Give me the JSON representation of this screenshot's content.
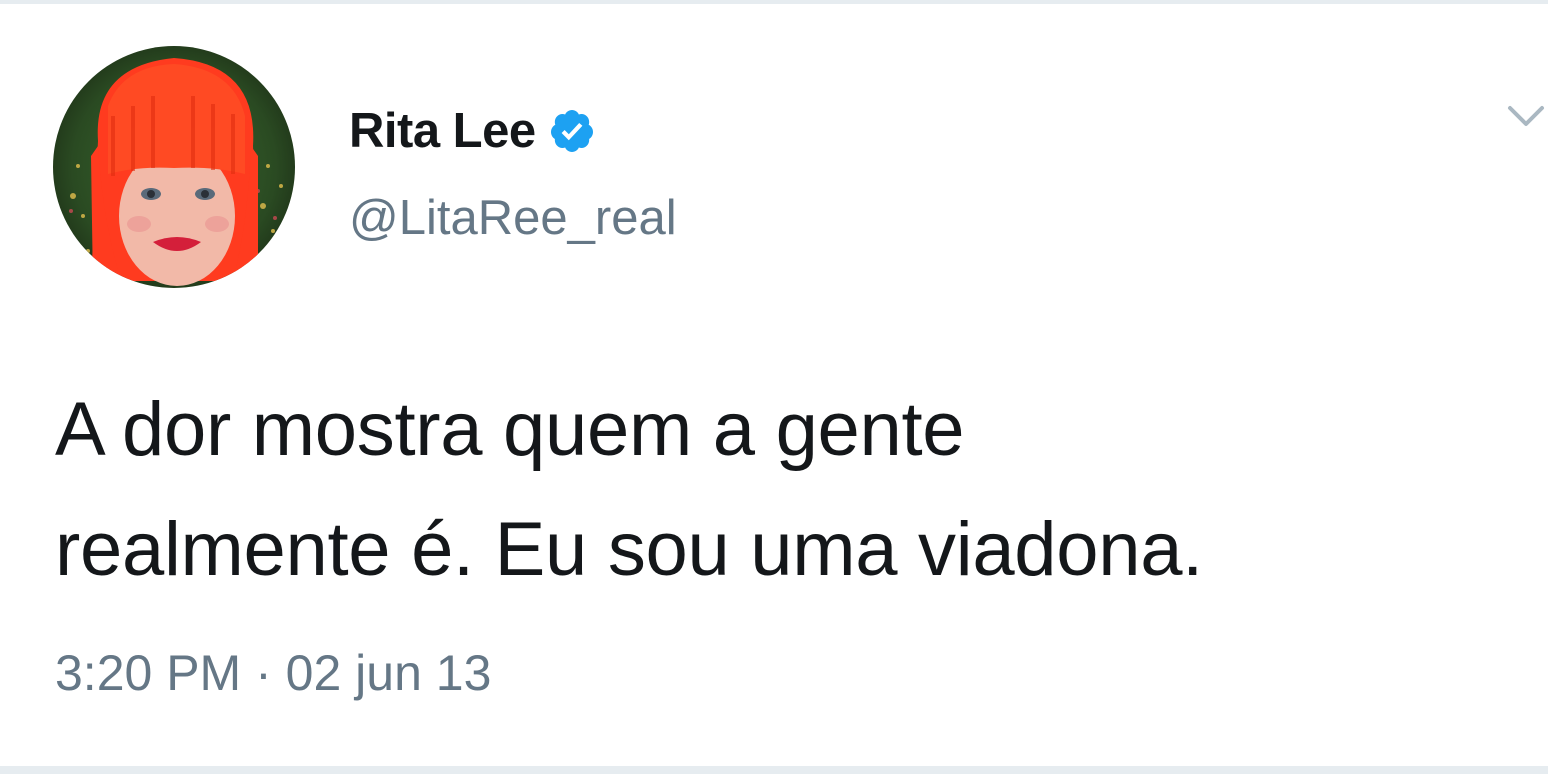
{
  "tweet": {
    "author": {
      "display_name": "Rita Lee",
      "handle": "@LitaRee_real",
      "verified": true,
      "avatar_icon": "profile-photo"
    },
    "text_lines": [
      "A dor mostra quem a gente",
      "realmente é. Eu sou uma viadona."
    ],
    "timestamp": "3:20 PM · 02 jun 13",
    "menu_icon": "chevron-down-icon"
  },
  "colors": {
    "text_primary": "#14171a",
    "text_secondary": "#657786",
    "verified_blue": "#1da1f2",
    "border": "#e6ecf0"
  }
}
